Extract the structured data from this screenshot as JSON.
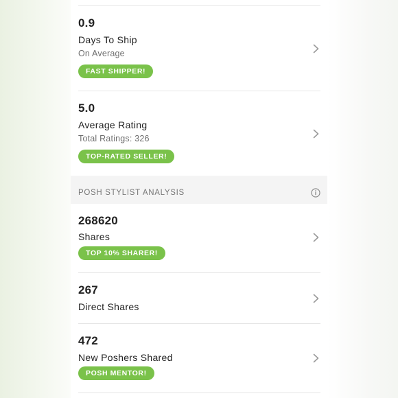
{
  "stats_top": [
    {
      "value": "0.9",
      "label": "Days To Ship",
      "sub": "On Average",
      "badge": "FAST SHIPPER!"
    },
    {
      "value": "5.0",
      "label": "Average Rating",
      "sub": "Total Ratings: 326",
      "badge": "TOP-RATED SELLER!"
    }
  ],
  "section": {
    "title": "POSH STYLIST ANALYSIS",
    "icon": "info-icon"
  },
  "stats_bottom": [
    {
      "value": "268620",
      "label": "Shares",
      "badge": "TOP 10% SHARER!"
    },
    {
      "value": "267",
      "label": "Direct Shares"
    },
    {
      "value": "472",
      "label": "New Poshers Shared",
      "badge": "POSH MENTOR!"
    }
  ],
  "colors": {
    "badge": "#7ac24a",
    "text": "#222222",
    "muted": "#6e6e6e"
  }
}
